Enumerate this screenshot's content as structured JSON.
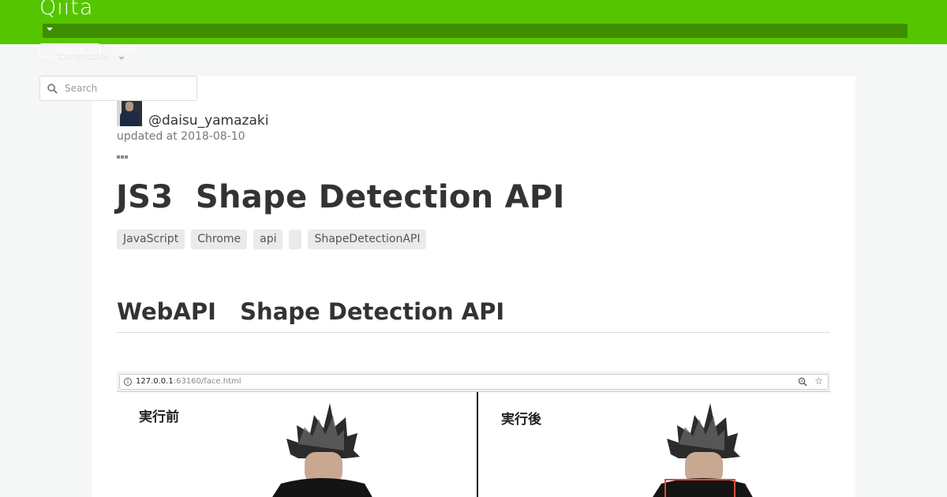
{
  "header": {
    "logo": "Qiita",
    "signup_label": "Signup",
    "login_label": "Login",
    "community_label": "Community"
  },
  "search": {
    "placeholder": "Search"
  },
  "article": {
    "author": "@daisu_yamazaki",
    "updated": "updated at 2018-08-10",
    "title": "JS3  Shape Detection API",
    "tags": [
      "JavaScript",
      "Chrome",
      "api",
      "",
      "ShapeDetectionAPI"
    ],
    "heading": "WebAPI   Shape Detection API"
  },
  "screenshot": {
    "url_host": "127.0.0.1",
    "url_path": ":63160/face.html",
    "label_before": "実行前",
    "label_after": "実行後"
  },
  "colors": {
    "brand": "#55c500",
    "brand_dark": "#3e8f00",
    "detect_box": "#e04a3a"
  }
}
